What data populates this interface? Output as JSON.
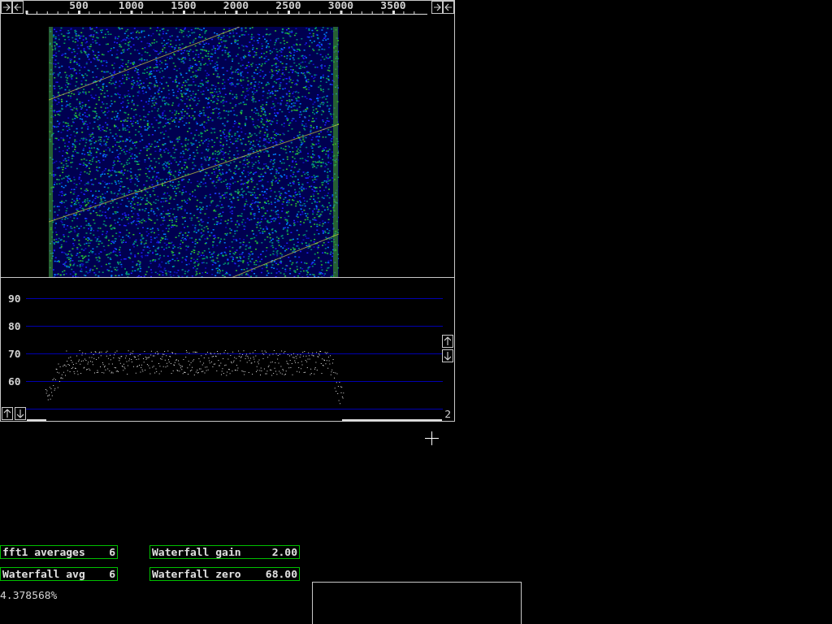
{
  "frequency_scale": {
    "labels": [
      "500",
      "1000",
      "1500",
      "2000",
      "2500",
      "3000",
      "3500"
    ]
  },
  "spectrum": {
    "y_labels": [
      "90",
      "80",
      "70",
      "60"
    ],
    "corner_label": "2"
  },
  "parameters": [
    {
      "label": "fft1 averages",
      "value": "6"
    },
    {
      "label": "Waterfall gain",
      "value": "2.00"
    },
    {
      "label": "Waterfall avg",
      "value": "6"
    },
    {
      "label": "Waterfall zero",
      "value": "68.00"
    }
  ],
  "status_text": "4.378568%"
}
